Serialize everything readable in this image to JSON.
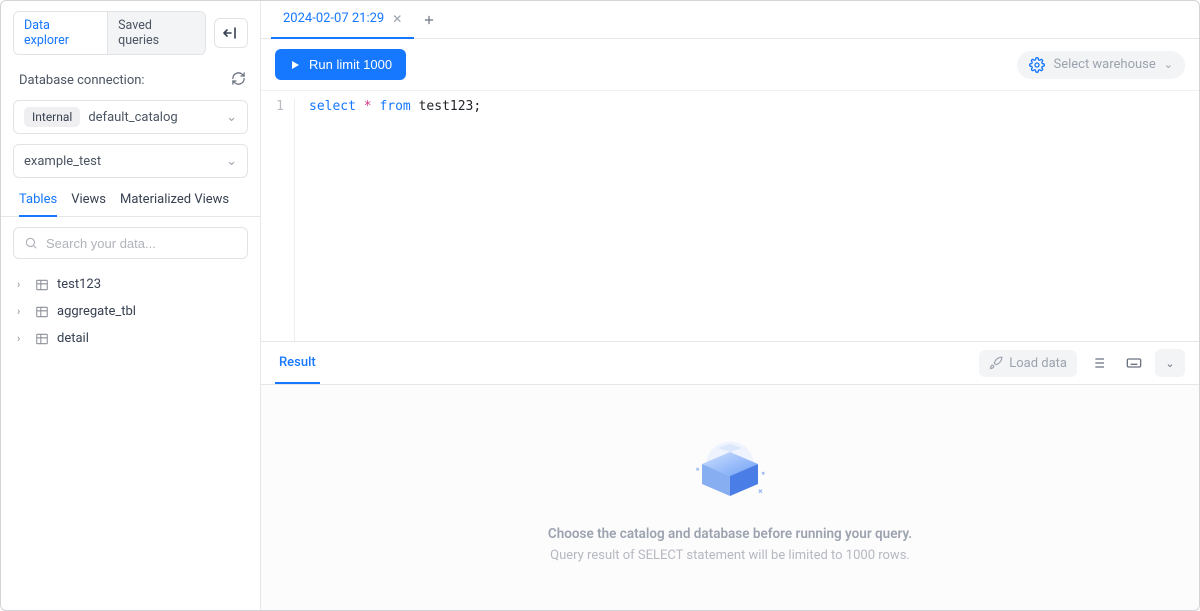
{
  "sidebar": {
    "tab_explorer": "Data explorer",
    "tab_saved": "Saved queries",
    "connection_label": "Database connection:",
    "catalog_pill": "Internal",
    "catalog_value": "default_catalog",
    "schema_value": "example_test",
    "subtabs": {
      "tables": "Tables",
      "views": "Views",
      "mviews": "Materialized Views"
    },
    "search_placeholder": "Search your data...",
    "tables": [
      {
        "name": "test123"
      },
      {
        "name": "aggregate_tbl"
      },
      {
        "name": "detail"
      }
    ]
  },
  "editor": {
    "tab_name": "2024-02-07 21:29",
    "run_label": "Run limit 1000",
    "warehouse_label": "Select warehouse",
    "line_number": "1",
    "sql": {
      "kw1": "select",
      "star": "*",
      "kw2": "from",
      "ident": " test123;"
    }
  },
  "results": {
    "tab_label": "Result",
    "load_data_label": "Load data",
    "empty_title": "Choose the catalog and database before running your query.",
    "empty_sub": "Query result of SELECT statement will be limited to 1000 rows."
  }
}
